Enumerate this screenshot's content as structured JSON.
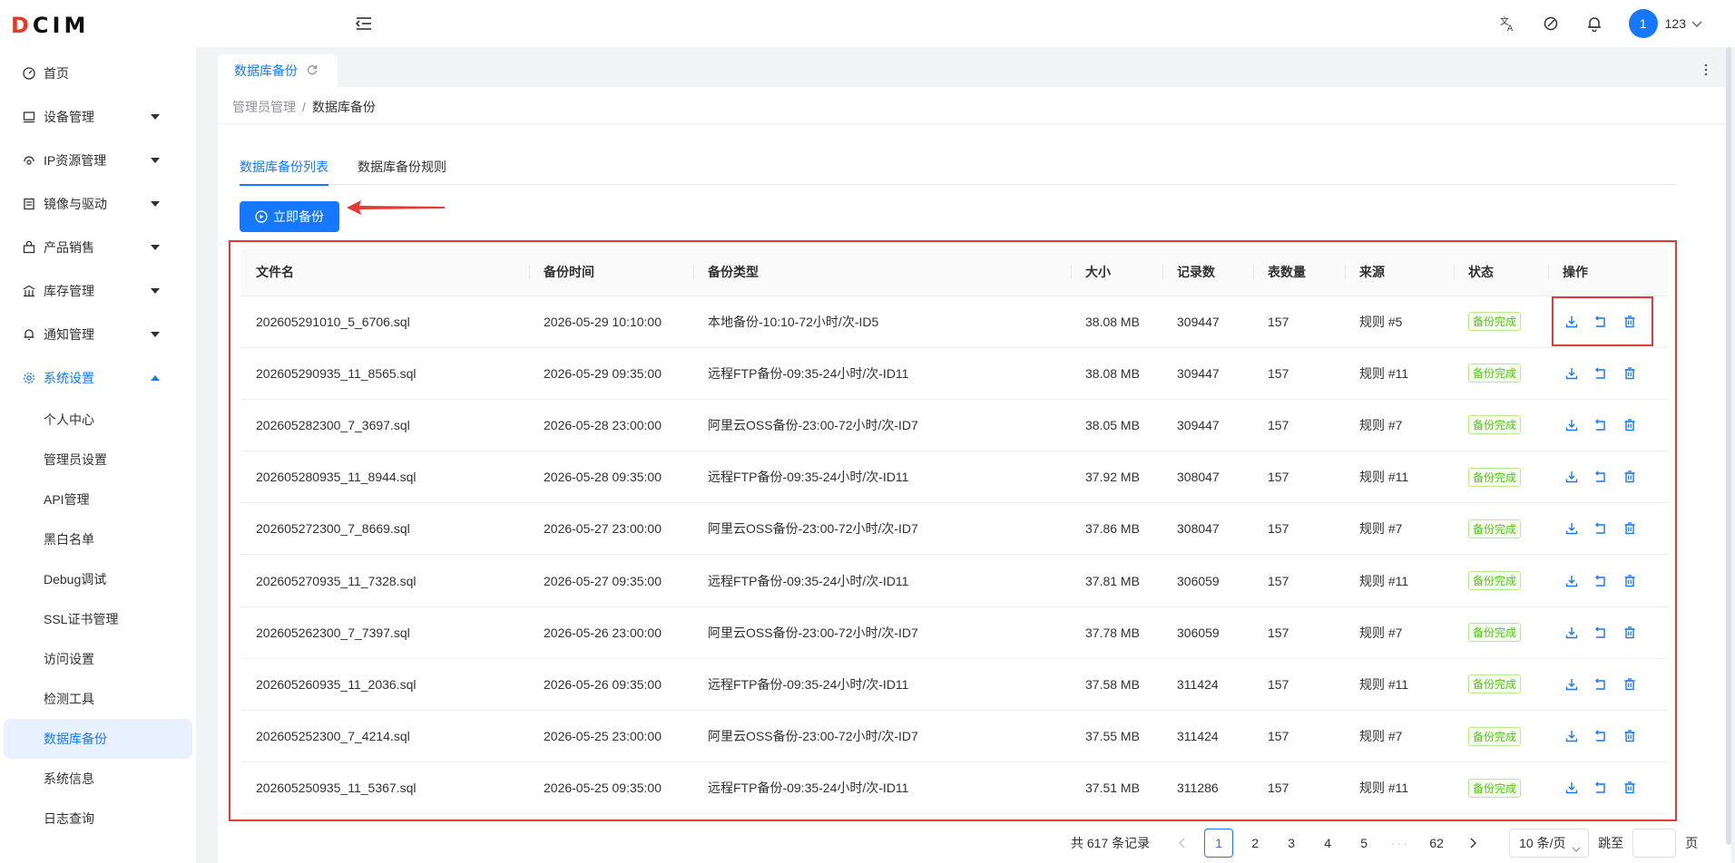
{
  "app": {
    "logo": "DCIM"
  },
  "sidebar": {
    "items": [
      {
        "label": "首页",
        "icon": "dashboard-icon",
        "expandable": false
      },
      {
        "label": "设备管理",
        "icon": "monitor-icon",
        "expandable": true
      },
      {
        "label": "IP资源管理",
        "icon": "network-icon",
        "expandable": true
      },
      {
        "label": "镜像与驱动",
        "icon": "disk-icon",
        "expandable": true
      },
      {
        "label": "产品销售",
        "icon": "shop-icon",
        "expandable": true
      },
      {
        "label": "库存管理",
        "icon": "warehouse-icon",
        "expandable": true
      },
      {
        "label": "通知管理",
        "icon": "bell-icon",
        "expandable": true
      },
      {
        "label": "系统设置",
        "icon": "gear-icon",
        "expandable": true,
        "open": true
      }
    ],
    "sub_items": [
      "个人中心",
      "管理员设置",
      "API管理",
      "黑白名单",
      "Debug调试",
      "SSL证书管理",
      "访问设置",
      "检测工具",
      "数据库备份",
      "系统信息",
      "日志查询"
    ],
    "active_sub": "数据库备份"
  },
  "header": {
    "avatar_text": "1",
    "user_name": "123"
  },
  "page_tab": {
    "label": "数据库备份"
  },
  "breadcrumb": {
    "parent": "管理员管理",
    "separator": "/",
    "current": "数据库备份"
  },
  "tabs": [
    {
      "label": "数据库备份列表",
      "active": true
    },
    {
      "label": "数据库备份规则",
      "active": false
    }
  ],
  "backup_button": {
    "label": "立即备份"
  },
  "table": {
    "columns": [
      "文件名",
      "备份时间",
      "备份类型",
      "大小",
      "记录数",
      "表数量",
      "来源",
      "状态",
      "操作"
    ],
    "rows": [
      {
        "file": "202605291010_5_6706.sql",
        "time": "2026-05-29 10:10:00",
        "type": "本地备份-10:10-72小时/次-ID5",
        "size": "38.08 MB",
        "records": "309447",
        "tables": "157",
        "source": "规则 #5",
        "status": "备份完成"
      },
      {
        "file": "202605290935_11_8565.sql",
        "time": "2026-05-29 09:35:00",
        "type": "远程FTP备份-09:35-24小时/次-ID11",
        "size": "38.08 MB",
        "records": "309447",
        "tables": "157",
        "source": "规则 #11",
        "status": "备份完成"
      },
      {
        "file": "202605282300_7_3697.sql",
        "time": "2026-05-28 23:00:00",
        "type": "阿里云OSS备份-23:00-72小时/次-ID7",
        "size": "38.05 MB",
        "records": "309447",
        "tables": "157",
        "source": "规则 #7",
        "status": "备份完成"
      },
      {
        "file": "202605280935_11_8944.sql",
        "time": "2026-05-28 09:35:00",
        "type": "远程FTP备份-09:35-24小时/次-ID11",
        "size": "37.92 MB",
        "records": "308047",
        "tables": "157",
        "source": "规则 #11",
        "status": "备份完成"
      },
      {
        "file": "202605272300_7_8669.sql",
        "time": "2026-05-27 23:00:00",
        "type": "阿里云OSS备份-23:00-72小时/次-ID7",
        "size": "37.86 MB",
        "records": "308047",
        "tables": "157",
        "source": "规则 #7",
        "status": "备份完成"
      },
      {
        "file": "202605270935_11_7328.sql",
        "time": "2026-05-27 09:35:00",
        "type": "远程FTP备份-09:35-24小时/次-ID11",
        "size": "37.81 MB",
        "records": "306059",
        "tables": "157",
        "source": "规则 #11",
        "status": "备份完成"
      },
      {
        "file": "202605262300_7_7397.sql",
        "time": "2026-05-26 23:00:00",
        "type": "阿里云OSS备份-23:00-72小时/次-ID7",
        "size": "37.78 MB",
        "records": "306059",
        "tables": "157",
        "source": "规则 #7",
        "status": "备份完成"
      },
      {
        "file": "202605260935_11_2036.sql",
        "time": "2026-05-26 09:35:00",
        "type": "远程FTP备份-09:35-24小时/次-ID11",
        "size": "37.58 MB",
        "records": "311424",
        "tables": "157",
        "source": "规则 #11",
        "status": "备份完成"
      },
      {
        "file": "202605252300_7_4214.sql",
        "time": "2026-05-25 23:00:00",
        "type": "阿里云OSS备份-23:00-72小时/次-ID7",
        "size": "37.55 MB",
        "records": "311424",
        "tables": "157",
        "source": "规则 #7",
        "status": "备份完成"
      },
      {
        "file": "202605250935_11_5367.sql",
        "time": "2026-05-25 09:35:00",
        "type": "远程FTP备份-09:35-24小时/次-ID11",
        "size": "37.51 MB",
        "records": "311286",
        "tables": "157",
        "source": "规则 #11",
        "status": "备份完成"
      }
    ]
  },
  "pagination": {
    "total": "共 617 条记录",
    "pages": [
      "1",
      "2",
      "3",
      "4",
      "5",
      "···",
      "62"
    ],
    "current": "1",
    "page_size": "10 条/页",
    "jump_label": "跳至",
    "page_suffix": "页"
  },
  "colors": {
    "primary": "#1677ff",
    "highlight": "#e53935",
    "success": "#52c41a"
  }
}
